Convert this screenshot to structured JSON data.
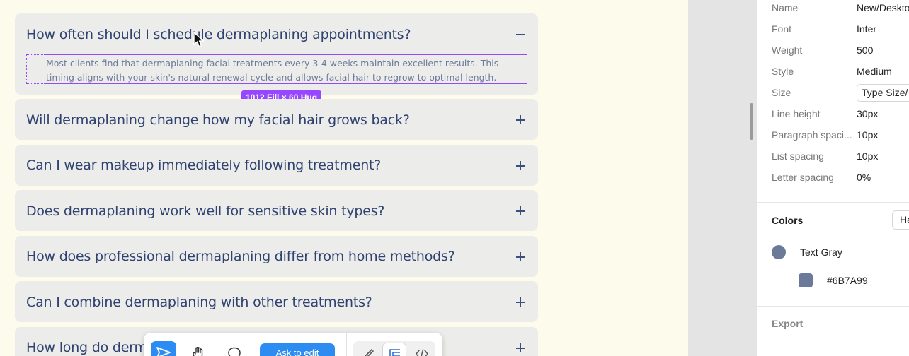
{
  "faq": {
    "items": [
      {
        "question": "How often should I schedule dermaplaning appointments?",
        "expanded": true,
        "toggle": "minus-icon"
      },
      {
        "question": "Will dermaplaning change how my facial hair grows back?",
        "expanded": false,
        "toggle": "plus-icon"
      },
      {
        "question": "Can I wear makeup immediately following treatment?",
        "expanded": false,
        "toggle": "plus-icon"
      },
      {
        "question": "Does dermaplaning work well for sensitive skin types?",
        "expanded": false,
        "toggle": "plus-icon"
      },
      {
        "question": "How does professional dermaplaning differ from home methods?",
        "expanded": false,
        "toggle": "plus-icon"
      },
      {
        "question": "Can I combine dermaplaning with other treatments?",
        "expanded": false,
        "toggle": "plus-icon"
      },
      {
        "question": "How long do derma",
        "expanded": false,
        "toggle": "plus-icon"
      }
    ],
    "answer_line1": "Most clients find that dermaplaning facial treatments every 3-4 weeks maintain excellent results. This",
    "answer_line2": "timing aligns with your skin's natural renewal cycle and allows facial hair to regrow to optimal length.",
    "selection_badge": "1012 Fill × 60 Hug"
  },
  "toolbar": {
    "tools": [
      "send-icon",
      "hand-icon",
      "comment-icon"
    ],
    "ask_edit_label": "Ask to edit",
    "modes": [
      "draw-icon",
      "layout-icon",
      "code-icon"
    ]
  },
  "panel": {
    "properties": [
      {
        "label": "Name",
        "value": "New/Desktop"
      },
      {
        "label": "Font",
        "value": "Inter"
      },
      {
        "label": "Weight",
        "value": "500"
      },
      {
        "label": "Style",
        "value": "Medium"
      },
      {
        "label": "Size",
        "value": "Type Size/"
      },
      {
        "label": "Line height",
        "value": "30px"
      },
      {
        "label": "Paragraph spaci...",
        "value": "10px"
      },
      {
        "label": "List spacing",
        "value": "10px"
      },
      {
        "label": "Letter spacing",
        "value": "0%"
      }
    ],
    "colors_title": "Colors",
    "colors_dropdown": "Hex",
    "color_name": "Text Gray",
    "color_hex": "#6B7A99",
    "export_title": "Export"
  },
  "colors": {
    "canvas_bg": "#fdfcec",
    "card_bg": "#ececea",
    "question_text": "#2f4270",
    "answer_text": "#6b7a99",
    "selection": "#9747ff",
    "accent": "#2c8cf2"
  }
}
